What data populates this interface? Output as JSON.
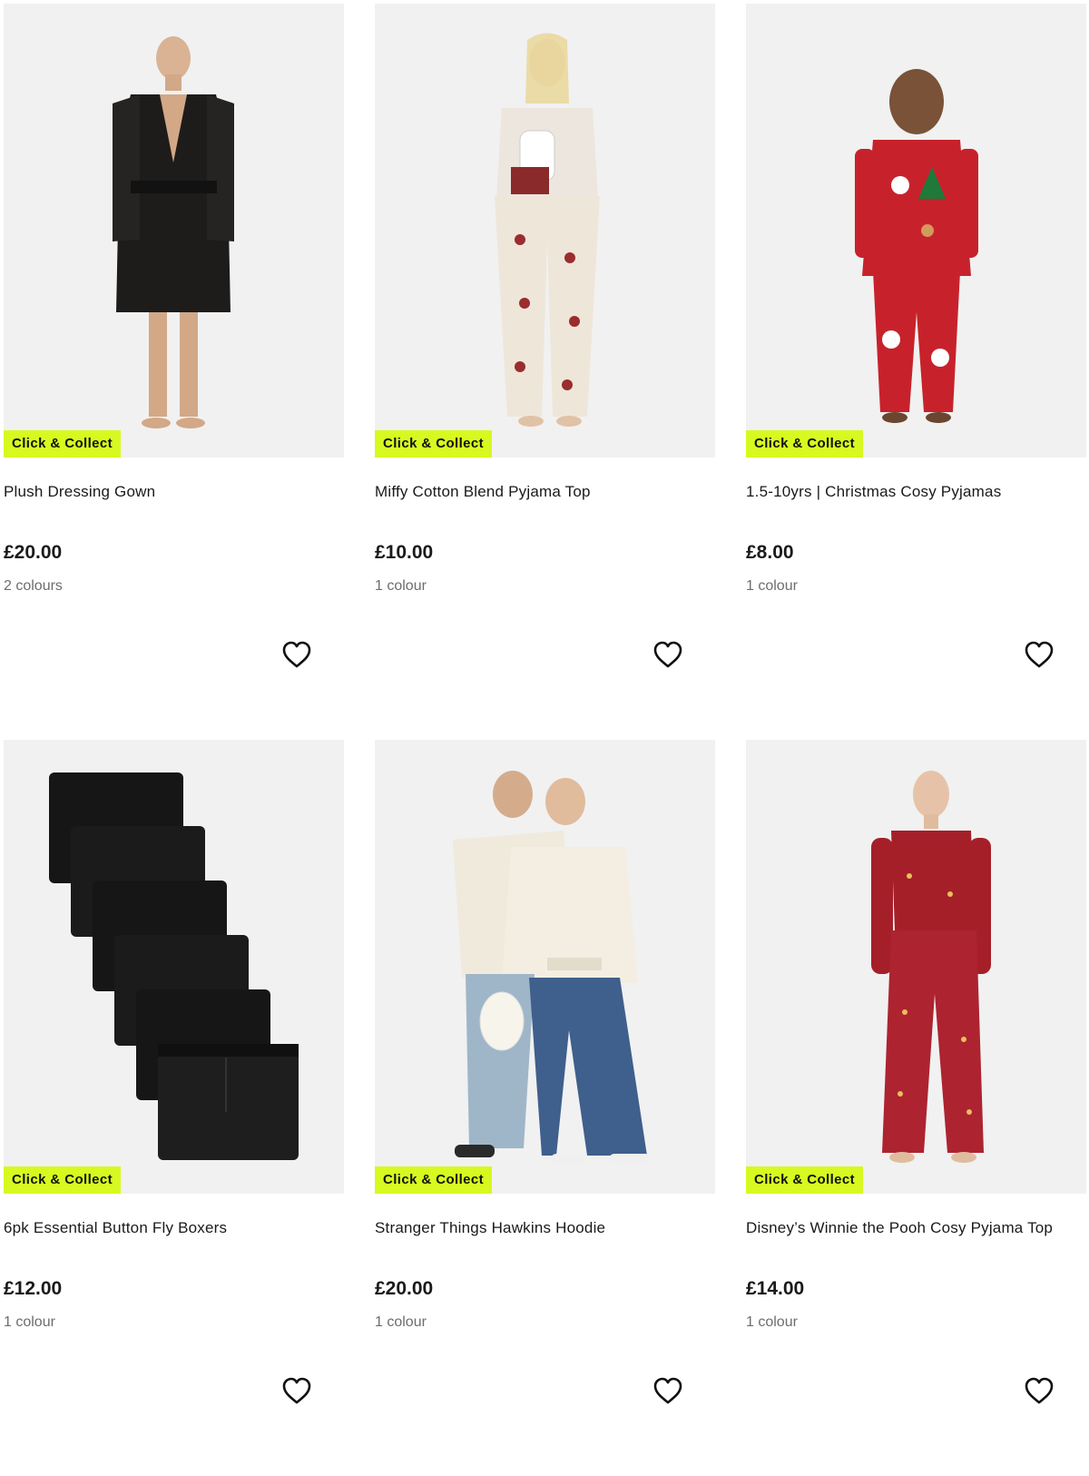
{
  "products": [
    {
      "title": "Plush Dressing Gown",
      "price": "£20.00",
      "colours": "2 colours",
      "badge": "Click & Collect"
    },
    {
      "title": "Miffy Cotton Blend Pyjama Top",
      "price": "£10.00",
      "colours": "1 colour",
      "badge": "Click & Collect"
    },
    {
      "title": "1.5-10yrs | Christmas Cosy Pyjamas",
      "price": "£8.00",
      "colours": "1 colour",
      "badge": "Click & Collect"
    },
    {
      "title": "6pk Essential Button Fly Boxers",
      "price": "£12.00",
      "colours": "1 colour",
      "badge": "Click & Collect"
    },
    {
      "title": "Stranger Things Hawkins Hoodie",
      "price": "£20.00",
      "colours": "1 colour",
      "badge": "Click & Collect"
    },
    {
      "title": "Disney’s Winnie the Pooh Cosy Pyjama Top",
      "price": "£14.00",
      "colours": "1 colour",
      "badge": "Click & Collect"
    }
  ],
  "colors": {
    "badge_bg": "#d8f91f",
    "photo_bg": "#f1f1f1",
    "text": "#1a1a1a",
    "muted": "#6d6d6d"
  },
  "icons": {
    "favourite": "heart-outline-icon"
  }
}
